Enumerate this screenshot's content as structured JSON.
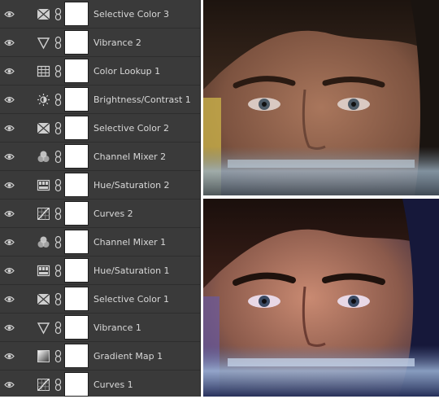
{
  "layers_panel": {
    "layers": [
      {
        "name": "Selective Color 3",
        "icon": "selective-color-icon"
      },
      {
        "name": "Vibrance 2",
        "icon": "vibrance-icon"
      },
      {
        "name": "Color Lookup 1",
        "icon": "color-lookup-icon"
      },
      {
        "name": "Brightness/Contrast 1",
        "icon": "brightness-contrast-icon"
      },
      {
        "name": "Selective Color 2",
        "icon": "selective-color-icon"
      },
      {
        "name": "Channel Mixer 2",
        "icon": "channel-mixer-icon"
      },
      {
        "name": "Hue/Saturation 2",
        "icon": "hue-saturation-icon"
      },
      {
        "name": "Curves 2",
        "icon": "curves-icon"
      },
      {
        "name": "Channel Mixer 1",
        "icon": "channel-mixer-icon"
      },
      {
        "name": "Hue/Saturation 1",
        "icon": "hue-saturation-icon"
      },
      {
        "name": "Selective Color 1",
        "icon": "selective-color-icon"
      },
      {
        "name": "Vibrance 1",
        "icon": "vibrance-icon"
      },
      {
        "name": "Gradient Map 1",
        "icon": "gradient-map-icon"
      },
      {
        "name": "Curves 1",
        "icon": "curves-icon"
      }
    ]
  },
  "photos": {
    "before": {
      "label": "before-edit photo"
    },
    "after": {
      "label": "after-edit photo"
    }
  },
  "colors": {
    "panel_bg": "#3a3a3a",
    "text": "#d8d8d8",
    "mask": "#ffffff"
  }
}
